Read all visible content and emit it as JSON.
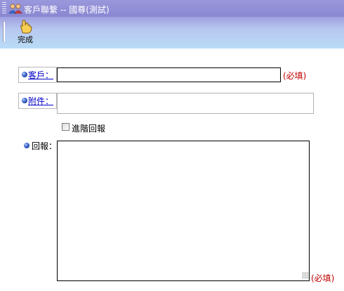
{
  "window": {
    "title": "客戶聯繫 -- 國尊(測試)"
  },
  "toolbar": {
    "done_label": "完成"
  },
  "form": {
    "customer": {
      "label": "客戶：",
      "value": "",
      "required": "(必填)"
    },
    "attachment": {
      "label": "附件：",
      "value": ""
    },
    "advanced_reply": {
      "label": "進階回報",
      "checked": false
    },
    "reply": {
      "label": "回報：",
      "value": "",
      "required": "(必填)"
    }
  },
  "colors": {
    "titlebar": "#8a87d2",
    "toolbar_bottom": "#b9dcf6",
    "link": "#0000c8",
    "required": "#c00000"
  },
  "icons": [
    "contacts-icon",
    "hand-pointer-icon",
    "bullet-icon"
  ]
}
